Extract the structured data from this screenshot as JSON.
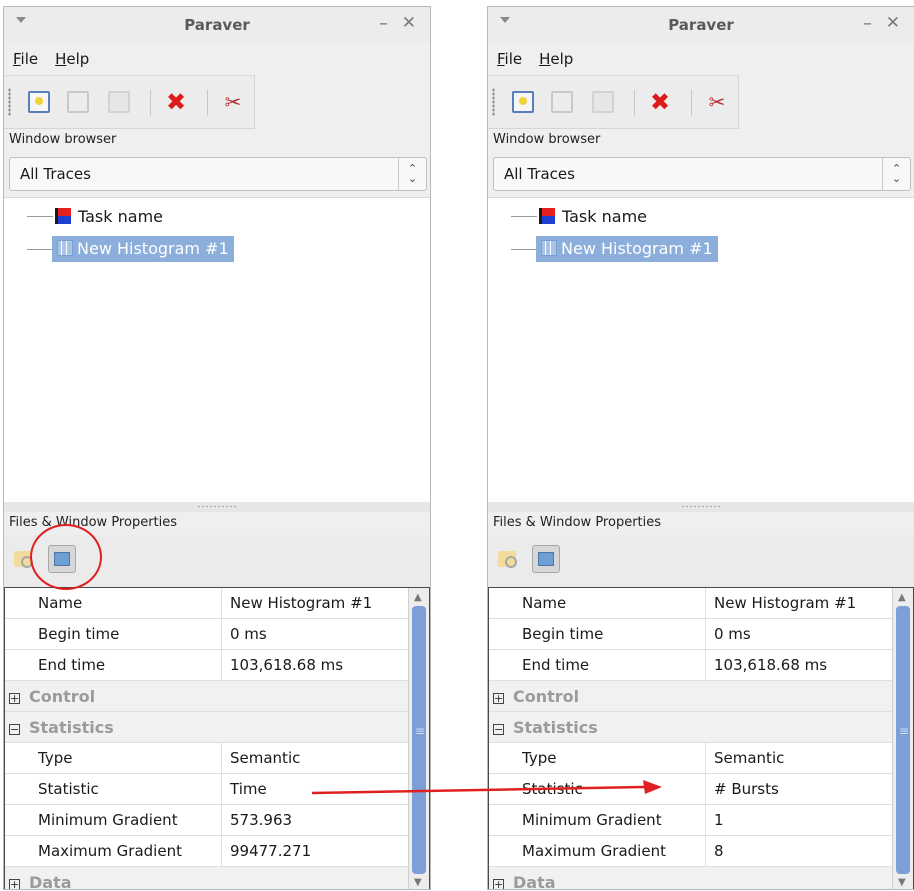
{
  "windows": [
    {
      "id": "left",
      "title": "Paraver",
      "minimize_glyph": "–",
      "close_glyph": "✕",
      "menu": [
        "File",
        "Help"
      ],
      "window_browser_label": "Window browser",
      "combo_value": "All Traces",
      "tree": [
        "Task name",
        "New Histogram #1"
      ],
      "properties_label": "Files & Window Properties",
      "rows": [
        {
          "label": "Name",
          "value": "New Histogram #1"
        },
        {
          "label": "Begin time",
          "value": "0 ms"
        },
        {
          "label": "End time",
          "value": "103,618.68 ms"
        }
      ],
      "cat_control": "Control",
      "cat_statistics": "Statistics",
      "stat_rows": [
        {
          "label": "Type",
          "value": "Semantic"
        },
        {
          "label": "Statistic",
          "value": "Time"
        },
        {
          "label": "Minimum Gradient",
          "value": "573.963"
        },
        {
          "label": "Maximum Gradient",
          "value": "99477.271"
        }
      ],
      "cat_data": "Data"
    },
    {
      "id": "right",
      "title": "Paraver",
      "minimize_glyph": "–",
      "close_glyph": "✕",
      "menu": [
        "File",
        "Help"
      ],
      "window_browser_label": "Window browser",
      "combo_value": "All Traces",
      "tree": [
        "Task name",
        "New Histogram #1"
      ],
      "properties_label": "Files & Window Properties",
      "rows": [
        {
          "label": "Name",
          "value": "New Histogram #1"
        },
        {
          "label": "Begin time",
          "value": "0 ms"
        },
        {
          "label": "End time",
          "value": "103,618.68 ms"
        }
      ],
      "cat_control": "Control",
      "cat_statistics": "Statistics",
      "stat_rows": [
        {
          "label": "Type",
          "value": "Semantic"
        },
        {
          "label": "Statistic",
          "value": "# Bursts"
        },
        {
          "label": "Minimum Gradient",
          "value": "1"
        },
        {
          "label": "Maximum Gradient",
          "value": "8"
        }
      ],
      "cat_data": "Data"
    }
  ],
  "glyphs": {
    "expand": "+",
    "collapse": "−",
    "combo_arrows": "⌃⌄",
    "scroll_up": "▲",
    "scroll_down": "▼",
    "cut": "✂",
    "delete": "✖"
  },
  "annotation": {
    "color": "#e02020"
  },
  "colors": {
    "selection": "#8caedb",
    "scroll_thumb": "#7c9fd8",
    "accent_red": "#dd1b1b"
  }
}
